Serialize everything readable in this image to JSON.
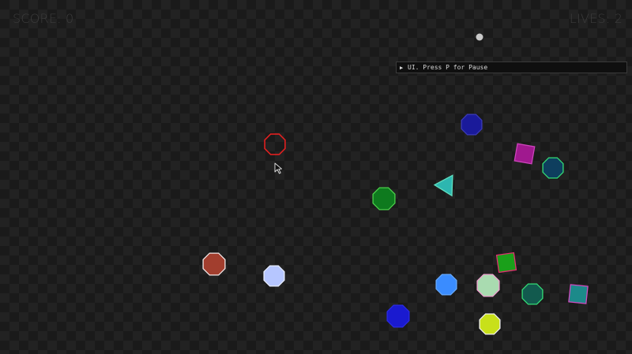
{
  "hud": {
    "score_label": "SCORE: 0",
    "lives_label": "LIVES: 2"
  },
  "ui_panel": {
    "toggle_icon": "play-triangle-icon",
    "label": "UI. Press P for Pause"
  },
  "colors": {
    "background": "#1a1a1a",
    "checker": "#222222",
    "hud_text": "#3c3c3c",
    "player_outline": "#e02020"
  },
  "entities": {
    "player": {
      "shape": "octagon",
      "stroke": "#e02020"
    },
    "cursor": {
      "icon": "mouse-pointer-icon"
    },
    "bullet": {
      "shape": "circle",
      "fill": "#c9c9c9"
    },
    "enemies": [
      {
        "name": "enemy-navy-octagon",
        "shape": "octagon",
        "fill": "#1a1a9a",
        "stroke": "#3a3ab8"
      },
      {
        "name": "enemy-magenta-square",
        "shape": "square",
        "fill": "#a0198f",
        "stroke": "#cc44bb"
      },
      {
        "name": "enemy-teal-octagon",
        "shape": "octagon",
        "fill": "#0e3e5e",
        "stroke": "#33dd77"
      },
      {
        "name": "enemy-cyan-triangle",
        "shape": "triangle",
        "fill": "#2db6b0",
        "stroke": "#5fe0c0"
      },
      {
        "name": "enemy-green-octagon",
        "shape": "octagon",
        "fill": "#0e7a1e",
        "stroke": "#4ad04a"
      },
      {
        "name": "enemy-brown-octagon",
        "shape": "octagon",
        "fill": "#a23e2e",
        "stroke": "#f0e6e6"
      },
      {
        "name": "enemy-lavender-octagon",
        "shape": "octagon",
        "fill": "#b6c6ff",
        "stroke": "#e8eeff"
      },
      {
        "name": "enemy-green-square",
        "shape": "square",
        "fill": "#1aa01a",
        "stroke": "#e03070"
      },
      {
        "name": "enemy-blue-octagon",
        "shape": "octagon",
        "fill": "#3a8cff",
        "stroke": "#66aaff"
      },
      {
        "name": "enemy-mint-octagon",
        "shape": "octagon",
        "fill": "#a9dbb0",
        "stroke": "#f0a0d0"
      },
      {
        "name": "enemy-darkteal-octagon",
        "shape": "octagon",
        "fill": "#125a4e",
        "stroke": "#33dd77"
      },
      {
        "name": "enemy-teal-square",
        "shape": "square",
        "fill": "#1c8a8a",
        "stroke": "#d04cc0"
      },
      {
        "name": "enemy-royalblue-octagon",
        "shape": "octagon",
        "fill": "#1a1ad0",
        "stroke": "#2a2ae0"
      },
      {
        "name": "enemy-lime-octagon",
        "shape": "octagon",
        "fill": "#c8e01a",
        "stroke": "#f0f0f0"
      }
    ]
  }
}
